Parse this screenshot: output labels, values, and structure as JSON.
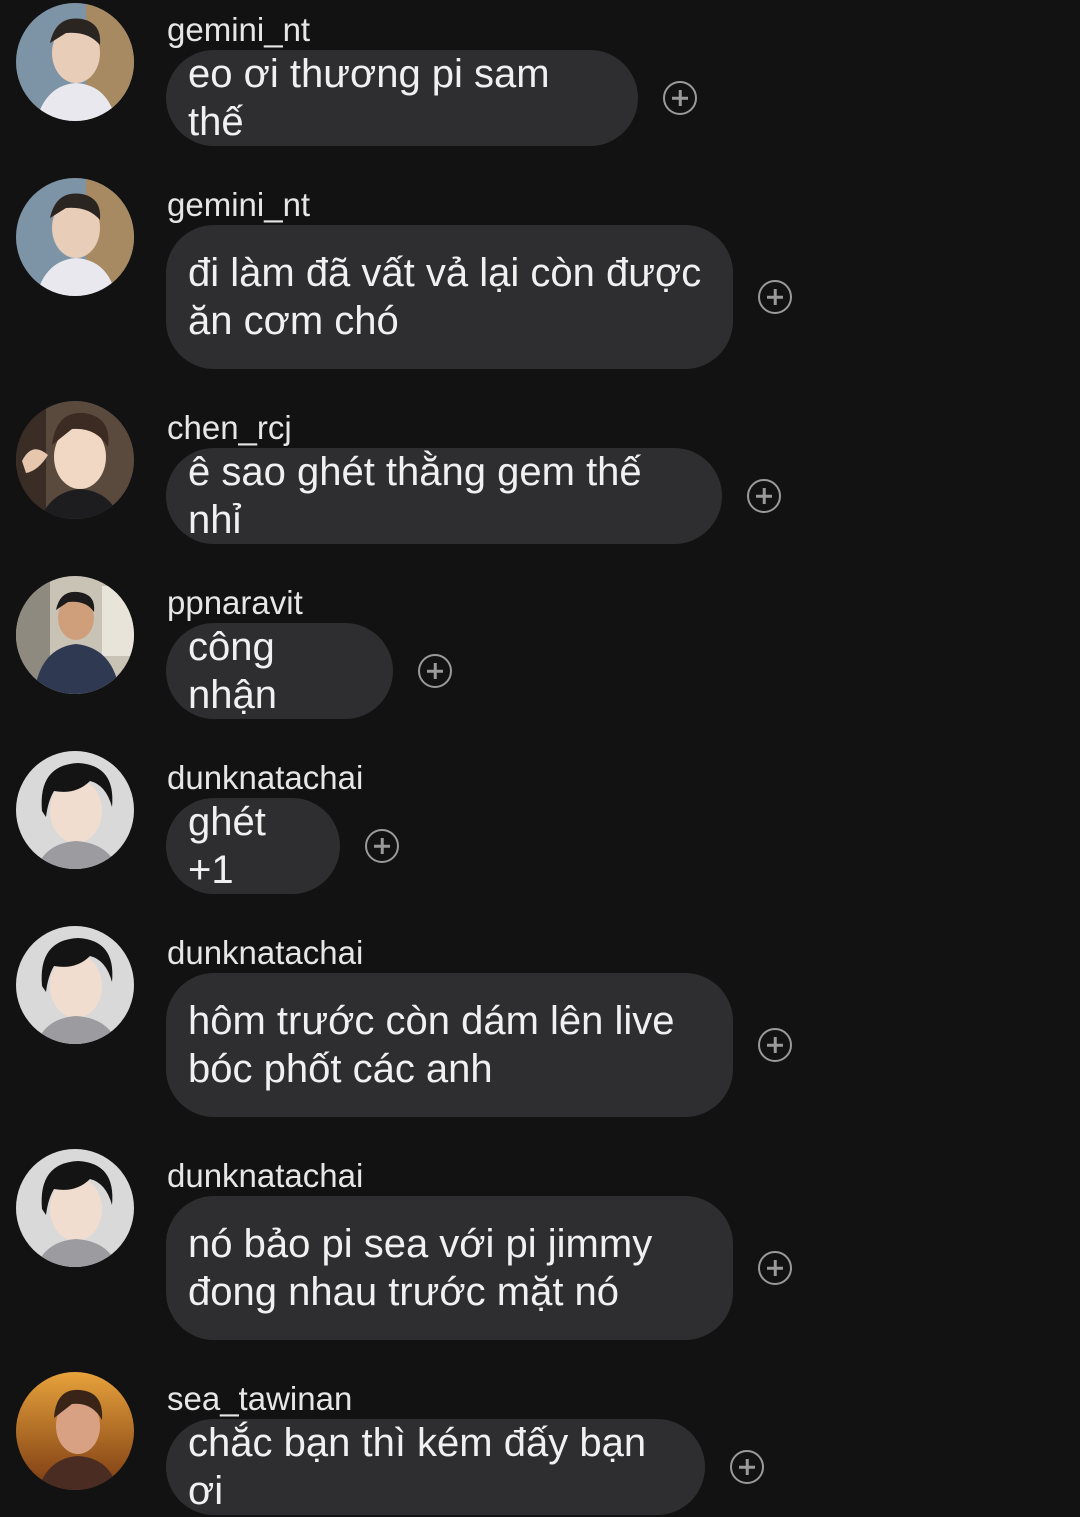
{
  "messages": [
    {
      "username": "gemini_nt",
      "text": "eo ơi thương pi sam thế",
      "avatar": "gemini-avatar"
    },
    {
      "username": "gemini_nt",
      "text": "đi làm đã vất vả lại còn được\năn cơm chó",
      "avatar": "gemini-avatar"
    },
    {
      "username": "chen_rcj",
      "text": "ê sao ghét thằng gem thế nhỉ",
      "avatar": "chen-avatar"
    },
    {
      "username": "ppnaravit",
      "text": "công nhận",
      "avatar": "ppnaravit-avatar"
    },
    {
      "username": "dunknatachai",
      "text": "ghét +1",
      "avatar": "dunk-avatar"
    },
    {
      "username": "dunknatachai",
      "text": "hôm trước còn dám lên live\nbóc phốt các anh",
      "avatar": "dunk-avatar"
    },
    {
      "username": "dunknatachai",
      "text": "nó bảo pi sea với pi jimmy\nđong nhau trước mặt nó",
      "avatar": "dunk-avatar"
    },
    {
      "username": "sea_tawinan",
      "text": "chắc bạn thì kém đấy bạn ơi",
      "avatar": "sea-avatar"
    }
  ],
  "icons": {
    "reaction": "add-reaction-icon"
  },
  "colors": {
    "background": "#121212",
    "bubble": "#2e2e30",
    "text": "#f0f0f0",
    "icon": "#9a9a9a"
  }
}
